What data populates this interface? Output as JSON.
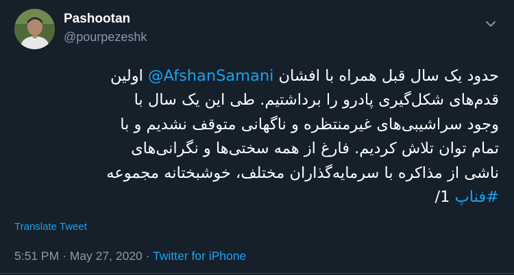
{
  "user": {
    "display_name": "Pashootan",
    "handle": "@pourpezeshk"
  },
  "tweet": {
    "lines": [
      {
        "before": "حدود یک سال قبل همراه با افشان ",
        "mention": "@AfshanSamani",
        "after": " اولین"
      },
      {
        "text": "قدم‌های شکل‌گیری پادرو را برداشتیم. طی این یک سال با"
      },
      {
        "text": "وجود سراشیبی‌های غیرمنتظره و ناگهانی متوقف نشدیم و با"
      },
      {
        "text": "تمام توان تلاش کردیم. فارغ از همه سختی‌ها و نگرانی‌های"
      },
      {
        "text": "ناشی از مذاکره با سرمایه‌گذاران مختلف، خوشبختانه مجموعه"
      },
      {
        "hashtag": "#فناپ",
        "after": " ‎1/"
      }
    ],
    "translate_label": "Translate Tweet",
    "time": "5:51 PM",
    "separator1": " · ",
    "date": "May 27, 2020",
    "separator2": " · ",
    "source": "Twitter for iPhone"
  },
  "icons": {
    "avatar": "avatar-photo",
    "menu": "chevron-down-icon"
  },
  "colors": {
    "background": "#15202b",
    "text": "#ffffff",
    "secondary": "#8899a6",
    "link": "#1da1f2",
    "divider": "#38444d"
  }
}
